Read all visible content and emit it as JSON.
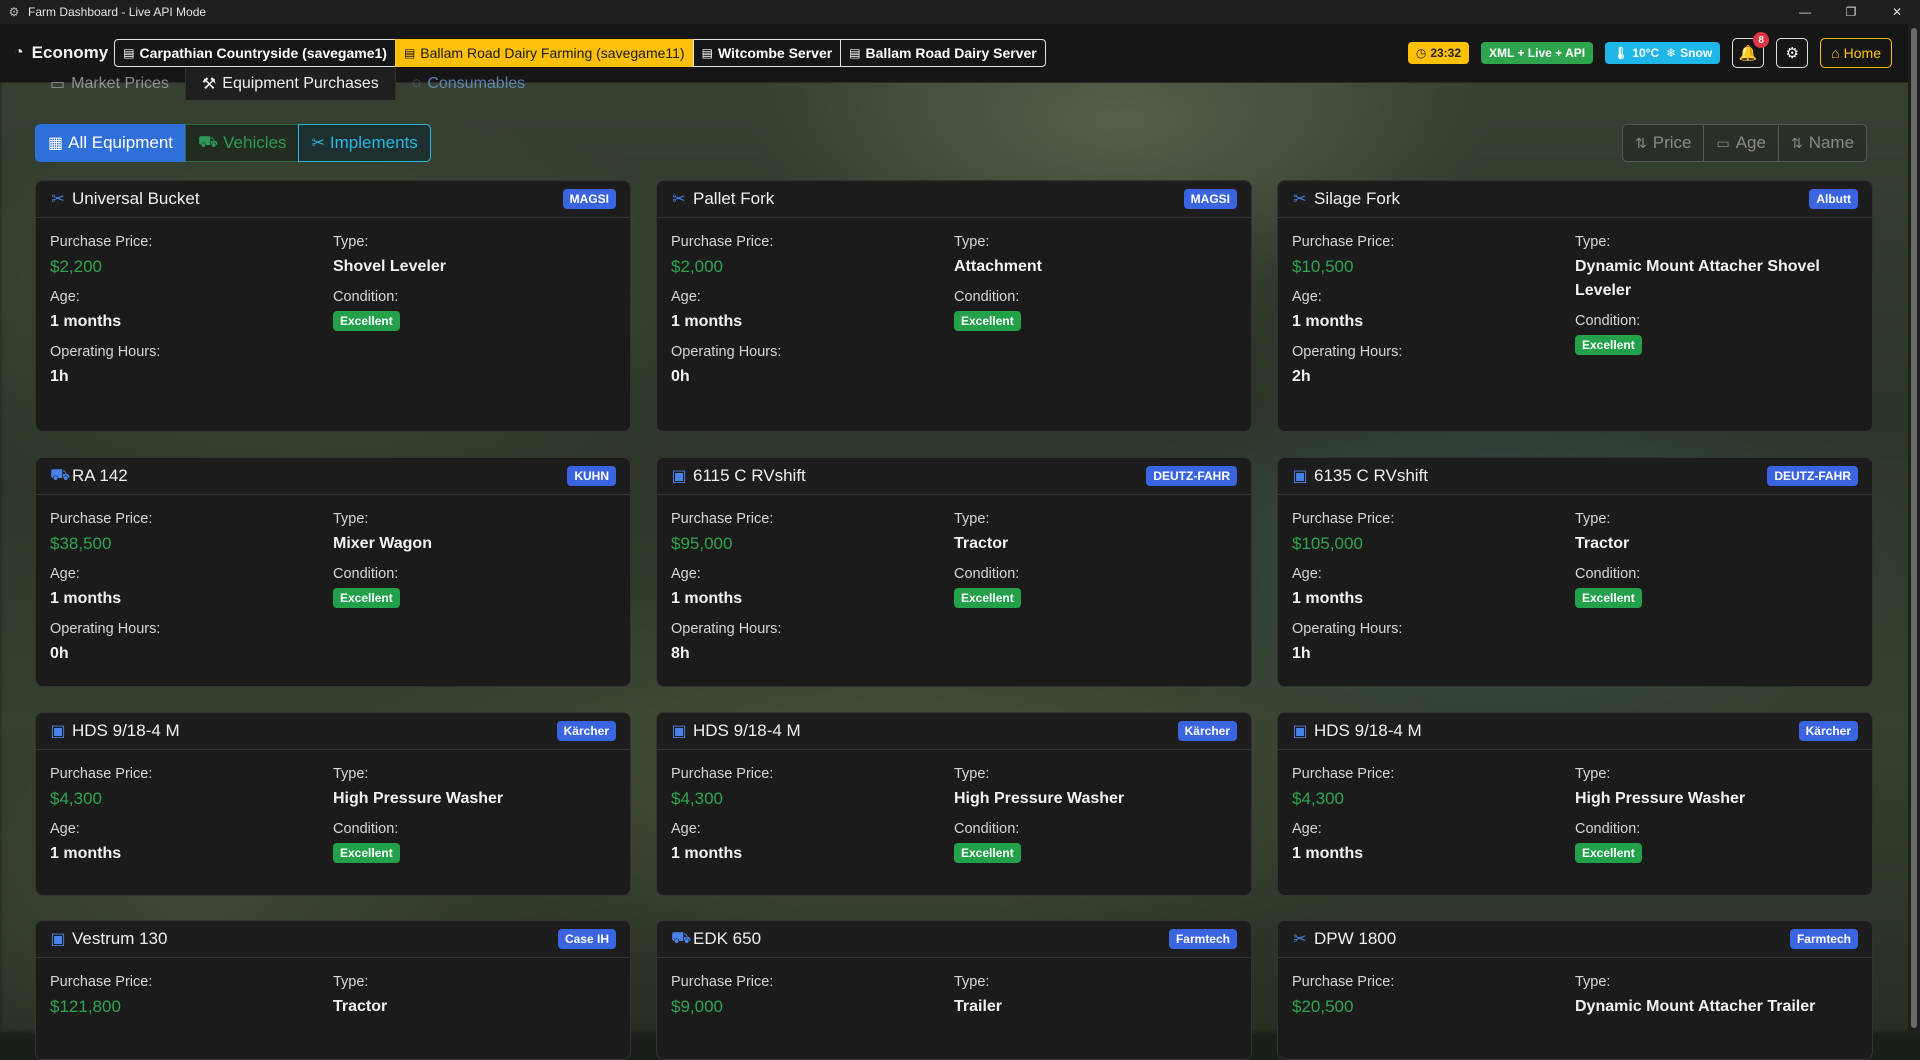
{
  "window": {
    "title": "Farm Dashboard - Live API Mode"
  },
  "navbar": {
    "brand": "Economy",
    "servers": [
      {
        "label": "Carpathian Countryside (savegame1)",
        "active": false
      },
      {
        "label": "Ballam Road Dairy Farming (savegame11)",
        "active": true
      },
      {
        "label": "Witcombe Server",
        "active": false
      },
      {
        "label": "Ballam Road Dairy Server",
        "active": false
      }
    ],
    "time": "23:32",
    "mode": "XML + Live + API",
    "temperature": "10°C",
    "weather": "Snow",
    "notifications_count": "8",
    "home_label": "Home"
  },
  "tabs": [
    {
      "label": "Market Prices"
    },
    {
      "label": "Equipment Purchases"
    },
    {
      "label": "Consumables"
    }
  ],
  "filters": {
    "all": "All Equipment",
    "vehicles": "Vehicles",
    "implements": "Implements"
  },
  "sort": {
    "price": "Price",
    "age": "Age",
    "name": "Name"
  },
  "labels": {
    "purchase_price": "Purchase Price:",
    "type": "Type:",
    "age": "Age:",
    "condition": "Condition:",
    "operating_hours": "Operating Hours:"
  },
  "colors": {
    "accent_blue": "#3b64e0",
    "price_green": "#2ea44f",
    "active_server": "#ffc107",
    "implements_cyan": "#29b8e0"
  },
  "cards": [
    {
      "icon": "implement-icon",
      "name": "Universal Bucket",
      "brand": "MAGSI",
      "price": "$2,200",
      "type": "Shovel Leveler",
      "age": "1 months",
      "condition": "Excellent",
      "hours": "1h"
    },
    {
      "icon": "implement-icon",
      "name": "Pallet Fork",
      "brand": "MAGSI",
      "price": "$2,000",
      "type": "Attachment",
      "age": "1 months",
      "condition": "Excellent",
      "hours": "0h"
    },
    {
      "icon": "implement-icon",
      "name": "Silage Fork",
      "brand": "Albutt",
      "price": "$10,500",
      "type": "Dynamic Mount Attacher Shovel Leveler",
      "age": "1 months",
      "condition": "Excellent",
      "hours": "2h"
    },
    {
      "icon": "truck-icon",
      "name": "RA 142",
      "brand": "KUHN",
      "price": "$38,500",
      "type": "Mixer Wagon",
      "age": "1 months",
      "condition": "Excellent",
      "hours": "0h"
    },
    {
      "icon": "tractor-icon",
      "name": "6115 C RVshift",
      "brand": "DEUTZ-FAHR",
      "price": "$95,000",
      "type": "Tractor",
      "age": "1 months",
      "condition": "Excellent",
      "hours": "8h"
    },
    {
      "icon": "tractor-icon",
      "name": "6135 C RVshift",
      "brand": "DEUTZ-FAHR",
      "price": "$105,000",
      "type": "Tractor",
      "age": "1 months",
      "condition": "Excellent",
      "hours": "1h"
    },
    {
      "icon": "tractor-icon",
      "name": "HDS 9/18-4 M",
      "brand": "Kärcher",
      "price": "$4,300",
      "type": "High Pressure Washer",
      "age": "1 months",
      "condition": "Excellent"
    },
    {
      "icon": "tractor-icon",
      "name": "HDS 9/18-4 M",
      "brand": "Kärcher",
      "price": "$4,300",
      "type": "High Pressure Washer",
      "age": "1 months",
      "condition": "Excellent"
    },
    {
      "icon": "tractor-icon",
      "name": "HDS 9/18-4 M",
      "brand": "Kärcher",
      "price": "$4,300",
      "type": "High Pressure Washer",
      "age": "1 months",
      "condition": "Excellent"
    },
    {
      "icon": "tractor-icon",
      "name": "Vestrum 130",
      "brand": "Case IH",
      "price": "$121,800",
      "type": "Tractor"
    },
    {
      "icon": "truck-icon",
      "name": "EDK 650",
      "brand": "Farmtech",
      "price": "$9,000",
      "type": "Trailer"
    },
    {
      "icon": "implement-icon",
      "name": "DPW 1800",
      "brand": "Farmtech",
      "price": "$20,500",
      "type": "Dynamic Mount Attacher Trailer"
    }
  ]
}
